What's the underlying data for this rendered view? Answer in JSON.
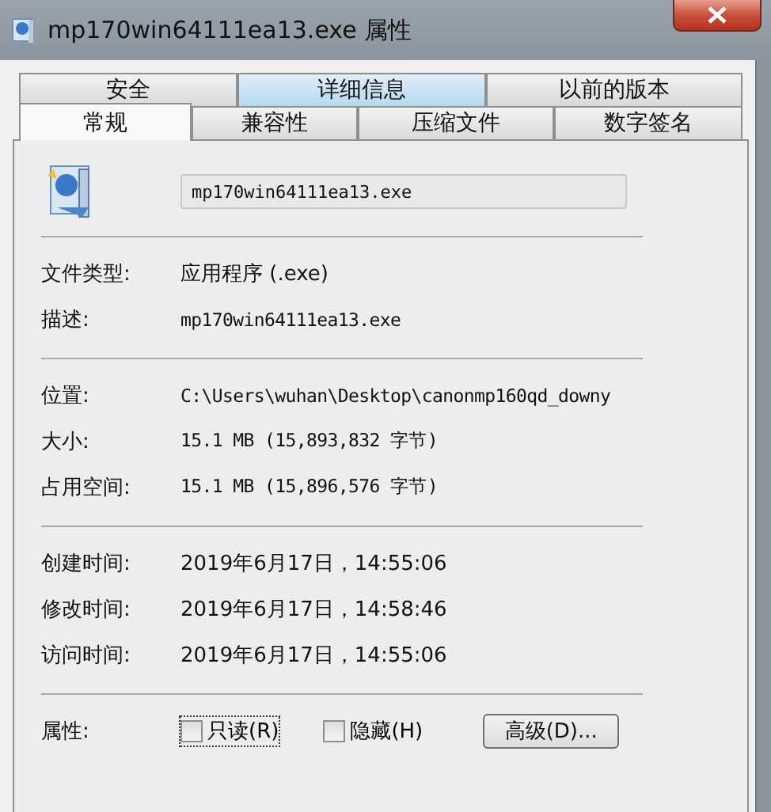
{
  "window": {
    "title": "mp170win64111ea13.exe 属性"
  },
  "tabs_back": [
    {
      "label": "安全",
      "selected": false,
      "hovered": false
    },
    {
      "label": "详细信息",
      "selected": false,
      "hovered": true
    },
    {
      "label": "以前的版本",
      "selected": false,
      "hovered": false
    }
  ],
  "tabs_front": [
    {
      "label": "常规",
      "selected": true,
      "hovered": false
    },
    {
      "label": "兼容性",
      "selected": false,
      "hovered": false
    },
    {
      "label": "压缩文件",
      "selected": false,
      "hovered": false
    },
    {
      "label": "数字签名",
      "selected": false,
      "hovered": false
    }
  ],
  "file_name": {
    "value": "mp170win64111ea13.exe"
  },
  "sections": [
    [
      {
        "label": "文件类型:",
        "value": "应用程序 (.exe)",
        "kind": "sans"
      },
      {
        "label": "描述:",
        "value": "mp170win64111ea13.exe",
        "kind": "mono"
      }
    ],
    [
      {
        "label": "位置:",
        "value": "C:\\Users\\wuhan\\Desktop\\canonmp160qd_downy",
        "kind": "mono"
      },
      {
        "label": "大小:",
        "value": "15.1 MB (15,893,832 字节)",
        "kind": "mono"
      },
      {
        "label": "占用空间:",
        "value": "15.1 MB (15,896,576 字节)",
        "kind": "mono"
      }
    ],
    [
      {
        "label": "创建时间:",
        "value": "2019年6月17日，14:55:06",
        "kind": "sans"
      },
      {
        "label": "修改时间:",
        "value": "2019年6月17日，14:58:46",
        "kind": "sans"
      },
      {
        "label": "访问时间:",
        "value": "2019年6月17日，14:55:06",
        "kind": "sans"
      }
    ]
  ],
  "attributes": {
    "label": "属性:",
    "options": [
      {
        "label": "只读(R)",
        "checked": false,
        "focused": true
      },
      {
        "label": "隐藏(H)",
        "checked": false,
        "focused": false
      }
    ],
    "button": "高级(D)..."
  }
}
